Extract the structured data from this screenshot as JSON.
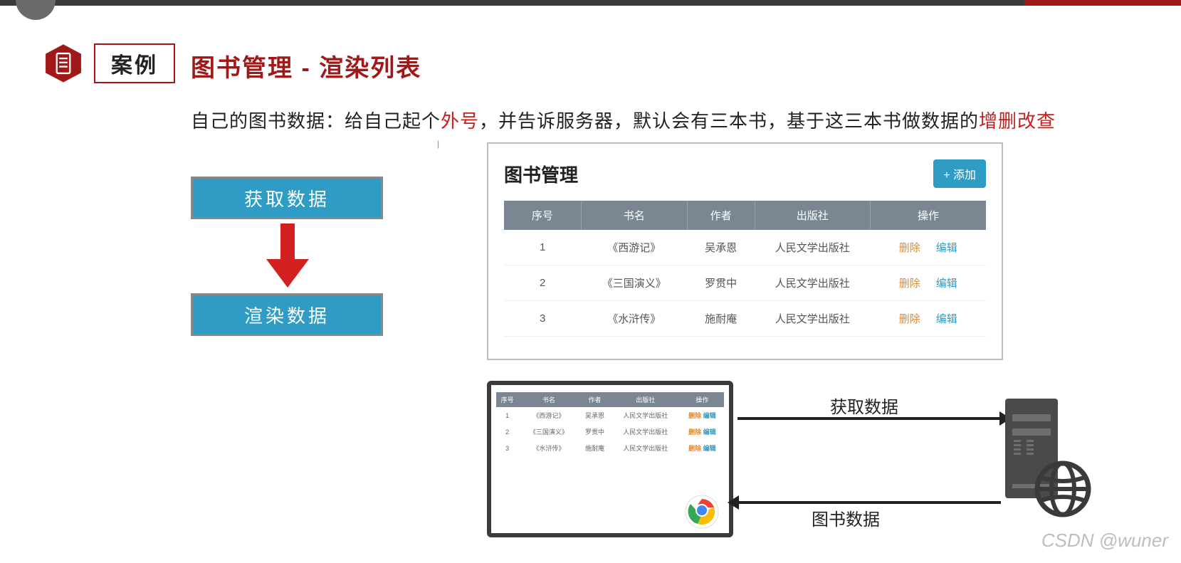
{
  "header": {
    "case_label": "案例",
    "page_title": "图书管理 - 渲染列表"
  },
  "description": {
    "prefix": "自己的图书数据：给自己起个",
    "red1": "外号",
    "mid": "，并告诉服务器，默认会有三本书，基于这三本书做数据的",
    "red2": "增删改查"
  },
  "flow": {
    "fetch_label": "获取数据",
    "render_label": "渲染数据"
  },
  "book_panel": {
    "title": "图书管理",
    "add_button": "+ 添加",
    "columns": {
      "index": "序号",
      "name": "书名",
      "author": "作者",
      "publisher": "出版社",
      "ops": "操作"
    },
    "op_delete": "删除",
    "op_edit": "编辑",
    "rows": [
      {
        "idx": "1",
        "name": "《西游记》",
        "author": "吴承恩",
        "publisher": "人民文学出版社"
      },
      {
        "idx": "2",
        "name": "《三国演义》",
        "author": "罗贯中",
        "publisher": "人民文学出版社"
      },
      {
        "idx": "3",
        "name": "《水浒传》",
        "author": "施耐庵",
        "publisher": "人民文学出版社"
      }
    ]
  },
  "diagram": {
    "fetch_arrow_label": "获取数据",
    "data_arrow_label": "图书数据",
    "mini_rows": [
      {
        "idx": "1",
        "name": "《西游记》",
        "author": "吴承恩",
        "publisher": "人民文学出版社"
      },
      {
        "idx": "2",
        "name": "《三国演义》",
        "author": "罗贯中",
        "publisher": "人民文学出版社"
      },
      {
        "idx": "3",
        "name": "《水浒传》",
        "author": "施耐庵",
        "publisher": "人民文学出版社"
      }
    ]
  },
  "watermark": "CSDN @wuner"
}
